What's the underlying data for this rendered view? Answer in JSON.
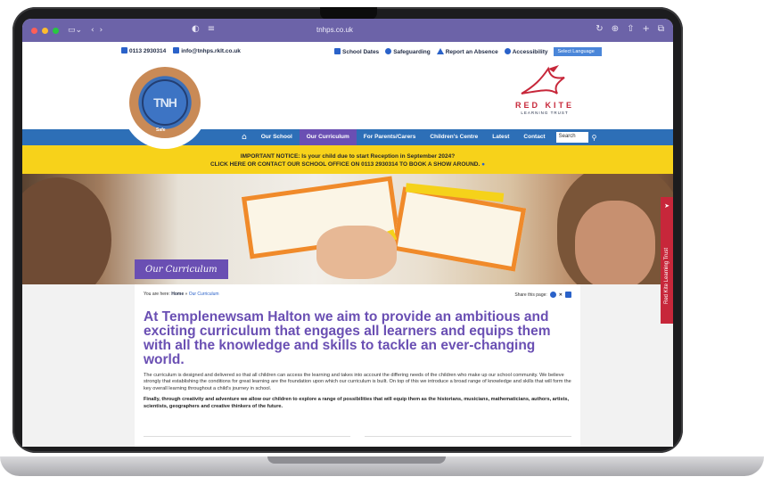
{
  "browser": {
    "url": "tnhps.co.uk"
  },
  "utility": {
    "phone": "0113 2930314",
    "email": "info@tnhps.rklt.co.uk",
    "links": [
      "School Dates",
      "Safeguarding",
      "Report an Absence",
      "Accessibility"
    ],
    "language": "Select Language"
  },
  "logo": {
    "initials": "TNH",
    "safe_text": "Safe"
  },
  "partner": {
    "name": "RED KITE",
    "sub": "LEARNING TRUST"
  },
  "nav": {
    "items": [
      "Our School",
      "Our Curriculum",
      "For Parents/Carers",
      "Children's Centre",
      "Latest",
      "Contact"
    ],
    "active_index": 1,
    "search_placeholder": "Search"
  },
  "notice": {
    "line1": "IMPORTANT NOTICE:  Is your child due to start Reception in September 2024?",
    "line2": "CLICK HERE OR CONTACT OUR SCHOOL OFFICE ON 0113 2930314 TO BOOK A SHOW AROUND."
  },
  "hero": {
    "page_tag": "Our Curriculum"
  },
  "side_tab": {
    "label": "Red Kite Learning Trust"
  },
  "content": {
    "crumbs_prefix": "You are here: ",
    "crumbs_home": "Home",
    "crumbs_sep": " » ",
    "crumbs_current": "Our Curriculum",
    "share_label": "Share this page:",
    "headline": "At Templenewsam Halton we aim to provide an ambitious and exciting curriculum that engages all learners and equips them with all the knowledge and skills to tackle an ever-changing world.",
    "body1": "The curriculum is designed and delivered so that all children can access the learning and takes into account the differing needs of the children who make up our school community. We believe strongly that establishing the conditions for great learning are the foundation upon which our curriculum is built. On top of this we introduce a broad range of knowledge and skills that will form the key overall learning throughout a child's journey in school.",
    "body2": "Finally, through creativity and adventure we allow our children to explore a range of possibilities that will equip them as the historians, musicians, mathematicians, authors, artists, scientists, geographers and creative thinkers of the future."
  },
  "colors": {
    "browser_bar": "#6c63a8",
    "nav_blue": "#2d6fb7",
    "active_purple": "#6a4fb3",
    "notice_yellow": "#f7d21a",
    "trust_red": "#c7273a"
  }
}
